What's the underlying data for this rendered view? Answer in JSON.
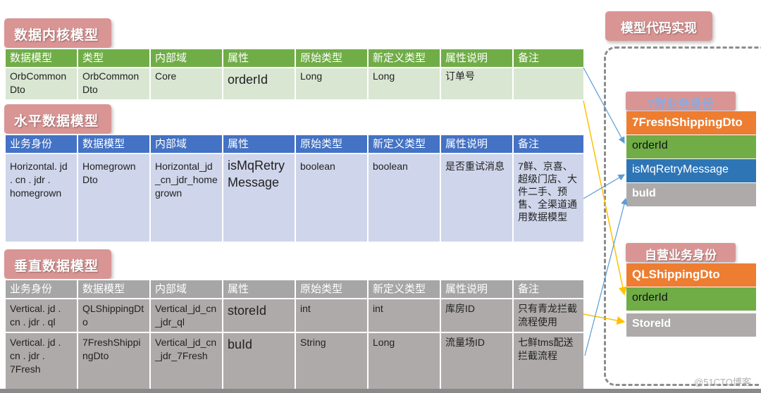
{
  "sections": {
    "core": {
      "title": "数据内核模型",
      "headers": [
        "数据模型",
        "类型",
        "内部域",
        "属性",
        "原始类型",
        "新定义类型",
        "属性说明",
        "备注"
      ],
      "rows": [
        [
          "OrbCommon Dto",
          "OrbCommon Dto",
          "Core",
          "orderId",
          "Long",
          "Long",
          "订单号",
          ""
        ]
      ]
    },
    "horizontal": {
      "title": "水平数据模型",
      "headers": [
        "业务身份",
        "数据模型",
        "内部域",
        "属性",
        "原始类型",
        "新定义类型",
        "属性说明",
        "备注"
      ],
      "rows": [
        [
          "Horizontal. jd . cn . jdr . homegrown",
          "Homegrown Dto",
          "Horizontal_jd_cn_jdr_homegrown",
          "isMqRetryMessage",
          "boolean",
          "boolean",
          "是否重试消息",
          "7鲜、京喜、超级门店、大件二手、预售、全渠道通用数据模型"
        ]
      ]
    },
    "vertical": {
      "title": "垂直数据模型",
      "headers": [
        "业务身份",
        "数据模型",
        "内部域",
        "属性",
        "原始类型",
        "新定义类型",
        "属性说明",
        "备注"
      ],
      "rows": [
        [
          "Vertical. jd . cn . jdr . ql",
          "QLShippingDto",
          "Vertical_jd_cn_jdr_ql",
          "storeId",
          "int",
          "int",
          "库房ID",
          "只有青龙拦截流程使用"
        ],
        [
          "Vertical. jd . cn . jdr . 7Fresh",
          "7FreshShippingDto",
          "Vertical_jd_cn_jdr_7Fresh",
          "buId",
          "String",
          "Long",
          "流量场ID",
          "七鲜tms配送拦截流程"
        ]
      ]
    }
  },
  "code": {
    "title": "模型代码实现",
    "fresh": {
      "identity": "7鲜业务身份",
      "dto": "7FreshShippingDto",
      "fields": [
        "orderId",
        "isMqRetryMessage",
        "buId"
      ]
    },
    "self": {
      "identity": "自营业务身份",
      "dto": "QLShippingDto",
      "fields": [
        "orderId",
        "StoreId"
      ]
    }
  },
  "arrow_colors": {
    "blue": "#5b9bd5",
    "orange": "#ffc000"
  },
  "watermark": "@51CTO博客"
}
